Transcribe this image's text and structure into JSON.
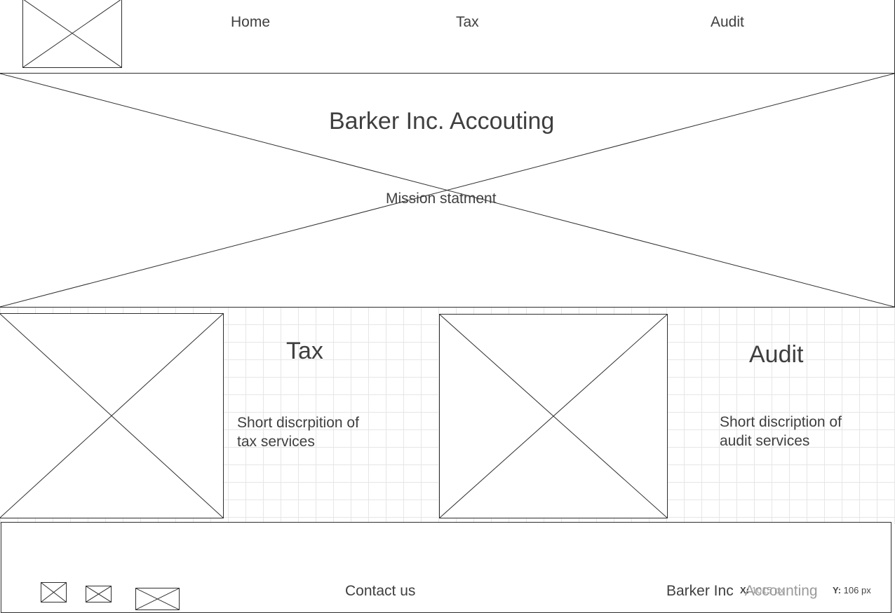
{
  "header": {
    "logo_icon": "image-placeholder-icon",
    "nav": [
      {
        "label": "Home"
      },
      {
        "label": "Tax"
      },
      {
        "label": "Audit"
      }
    ]
  },
  "hero": {
    "image_icon": "image-placeholder-icon",
    "title": "Barker Inc. Accouting",
    "subtitle": "Mission statment"
  },
  "services": [
    {
      "title": "Tax",
      "description": "Short discrpition of tax services",
      "image_icon": "image-placeholder-icon"
    },
    {
      "title": "Audit",
      "description": "Short discription of audit services",
      "image_icon": "image-placeholder-icon"
    }
  ],
  "footer": {
    "social_icons": [
      "image-placeholder-icon",
      "image-placeholder-icon",
      "image-placeholder-icon"
    ],
    "contact_label": "Contact us",
    "company_name_part1": "Barker Inc",
    "company_name_part2": "Accounting"
  },
  "coordinates": {
    "x_label": "X:",
    "x_value": "1015 px",
    "y_label": "Y:",
    "y_value": "106 px"
  },
  "colors": {
    "stroke": "#2d2d2d",
    "text": "#3f3f3f",
    "grid": "#e6e6e6",
    "faded_text": "#9a9a9a"
  }
}
